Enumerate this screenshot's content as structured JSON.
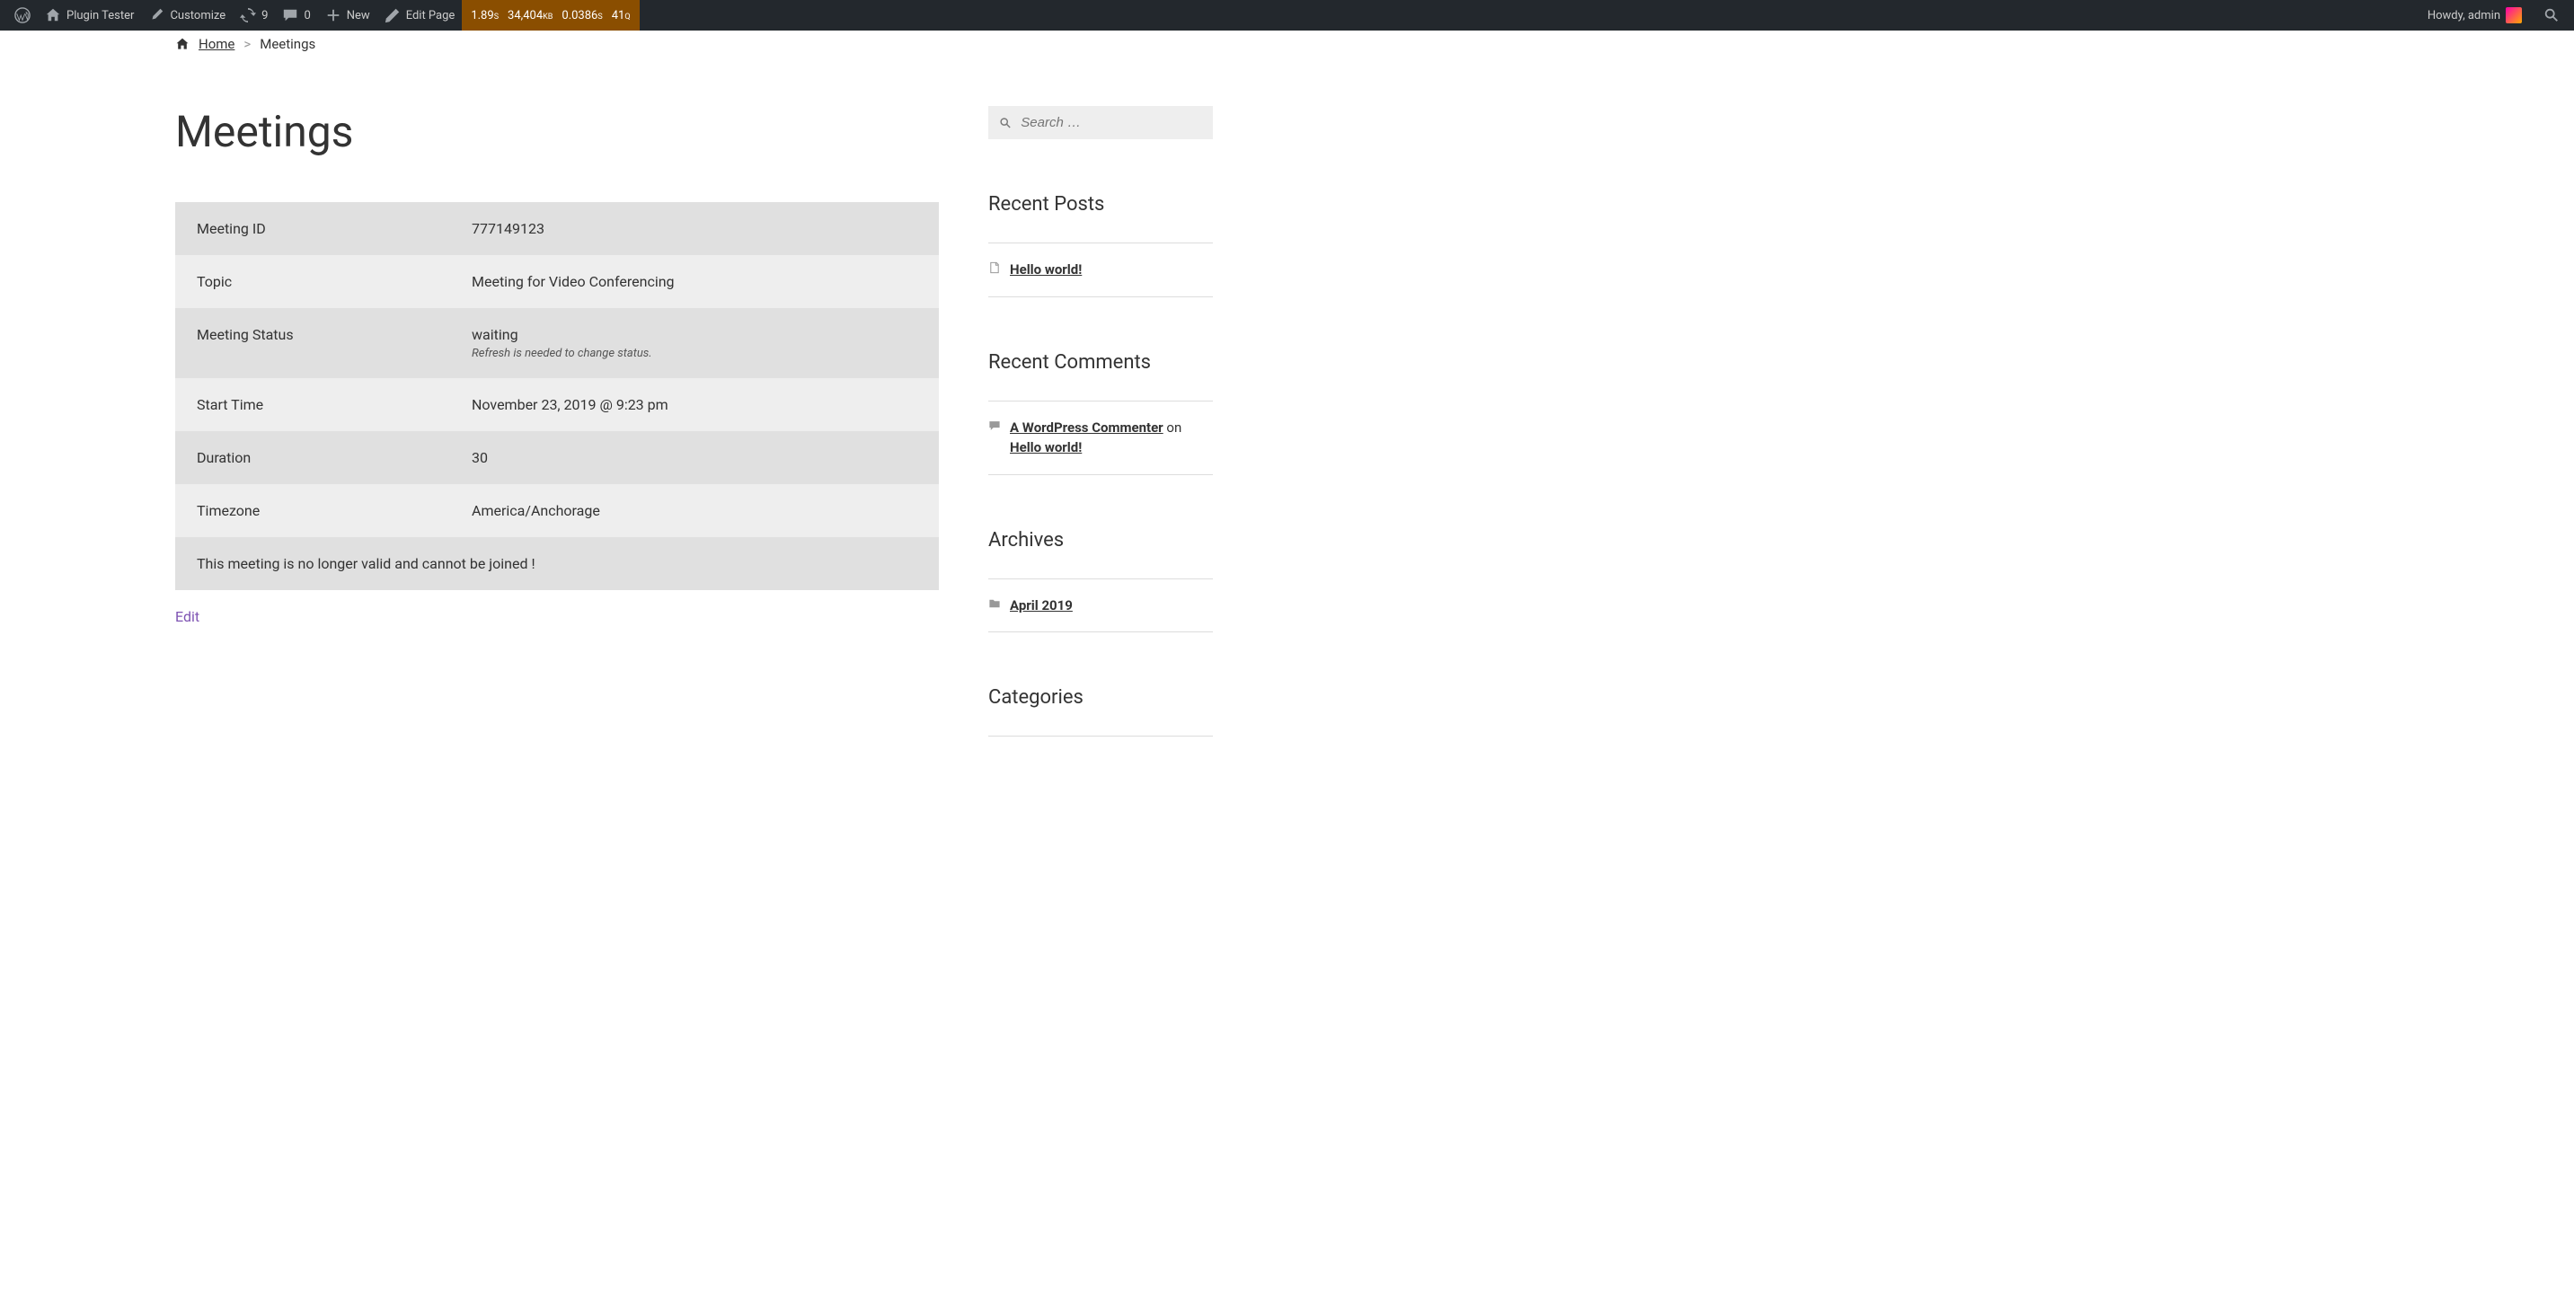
{
  "adminbar": {
    "plugin_tester": "Plugin Tester",
    "customize": "Customize",
    "updates_count": "9",
    "comments_count": "0",
    "new": "New",
    "edit_page": "Edit Page",
    "perf": {
      "time": "1.89",
      "time_unit": "S",
      "mem": "34,404",
      "mem_unit": "KB",
      "db_time": "0.0386",
      "db_time_unit": "S",
      "queries": "41",
      "queries_unit": "Q"
    },
    "howdy": "Howdy, admin"
  },
  "breadcrumb": {
    "home": "Home",
    "current": "Meetings"
  },
  "page_title": "Meetings",
  "meeting": {
    "rows": {
      "id_label": "Meeting ID",
      "id_value": "777149123",
      "topic_label": "Topic",
      "topic_value": "Meeting for Video Conferencing",
      "status_label": "Meeting Status",
      "status_value": "waiting",
      "status_note": "Refresh is needed to change status.",
      "start_label": "Start Time",
      "start_value": "November 23, 2019 @ 9:23 pm",
      "duration_label": "Duration",
      "duration_value": "30",
      "timezone_label": "Timezone",
      "timezone_value": "America/Anchorage"
    },
    "invalid_notice": "This meeting is no longer valid and cannot be joined !"
  },
  "edit_link": "Edit",
  "sidebar": {
    "search_placeholder": "Search …",
    "recent_posts_title": "Recent Posts",
    "recent_posts": [
      {
        "title": "Hello world!"
      }
    ],
    "recent_comments_title": "Recent Comments",
    "recent_comments": [
      {
        "author": "A WordPress Commenter",
        "on": " on ",
        "post": "Hello world!"
      }
    ],
    "archives_title": "Archives",
    "archives": [
      {
        "label": "April 2019"
      }
    ],
    "categories_title": "Categories"
  }
}
